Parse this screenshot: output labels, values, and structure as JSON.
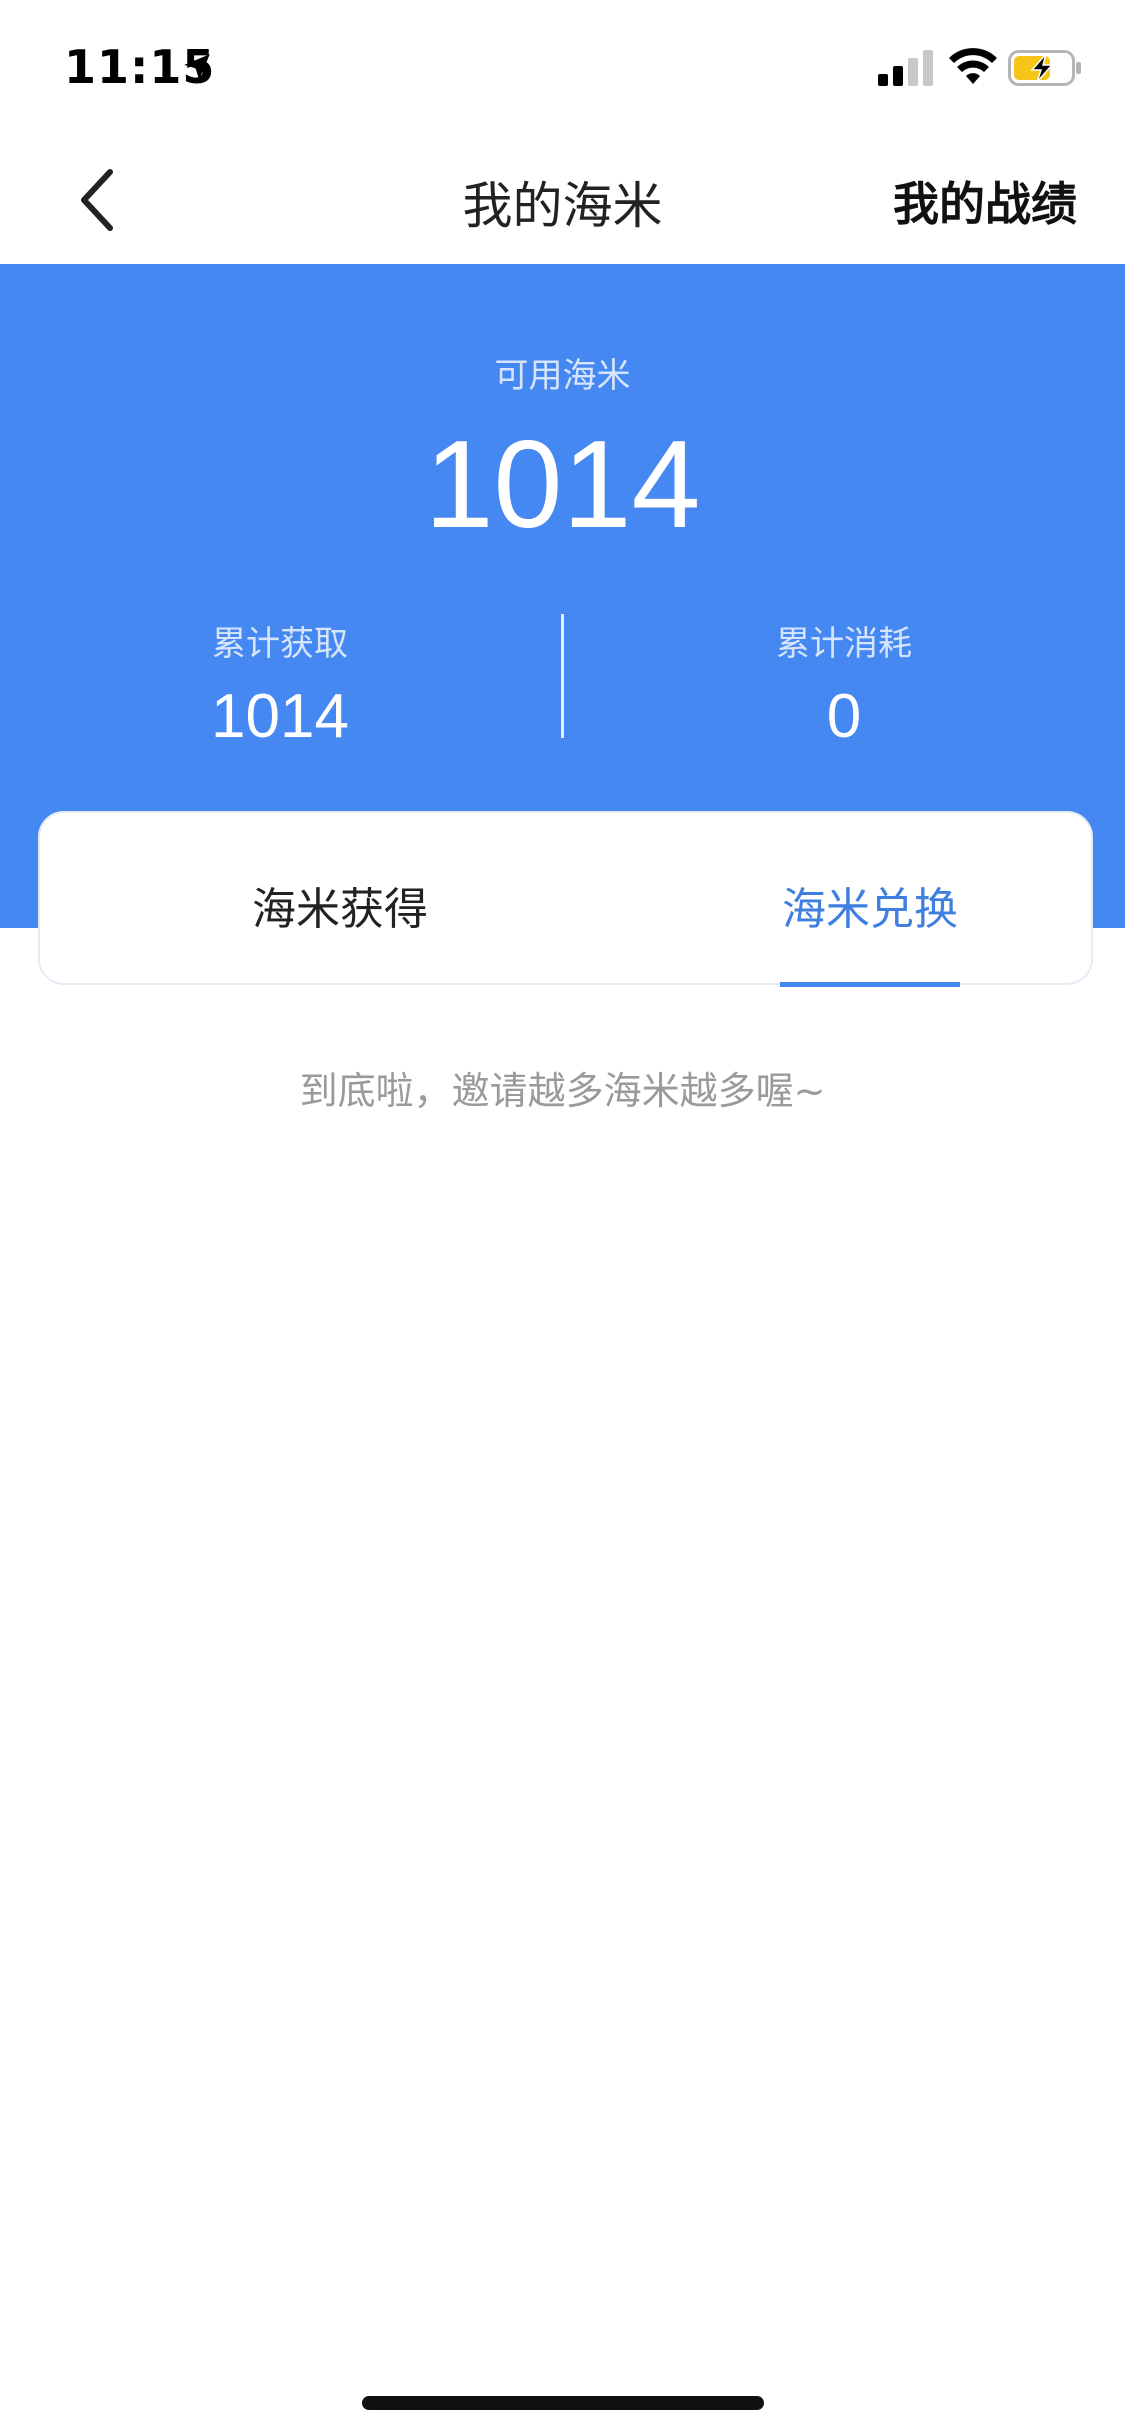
{
  "status_bar": {
    "time": "11:15",
    "icons": [
      "location-arrow-icon",
      "signal-icon",
      "wifi-icon",
      "battery-charging-icon"
    ],
    "battery_color": "#f5c518"
  },
  "nav": {
    "title": "我的海米",
    "right_action": "我的战绩",
    "back_icon": "chevron-left-icon"
  },
  "summary": {
    "available_label": "可用海米",
    "available_value": "1014",
    "earned_label": "累计获取",
    "earned_value": "1014",
    "spent_label": "累计消耗",
    "spent_value": "0",
    "background_color": "#4688f1"
  },
  "tabs": [
    {
      "label": "海米获得",
      "active": false
    },
    {
      "label": "海米兑换",
      "active": true
    }
  ],
  "empty_state": {
    "message": "到底啦，邀请越多海米越多喔~"
  },
  "colors": {
    "accent": "#4688f1",
    "active_tab_text": "#3f7fe0",
    "muted_text": "#9a9a9a"
  }
}
